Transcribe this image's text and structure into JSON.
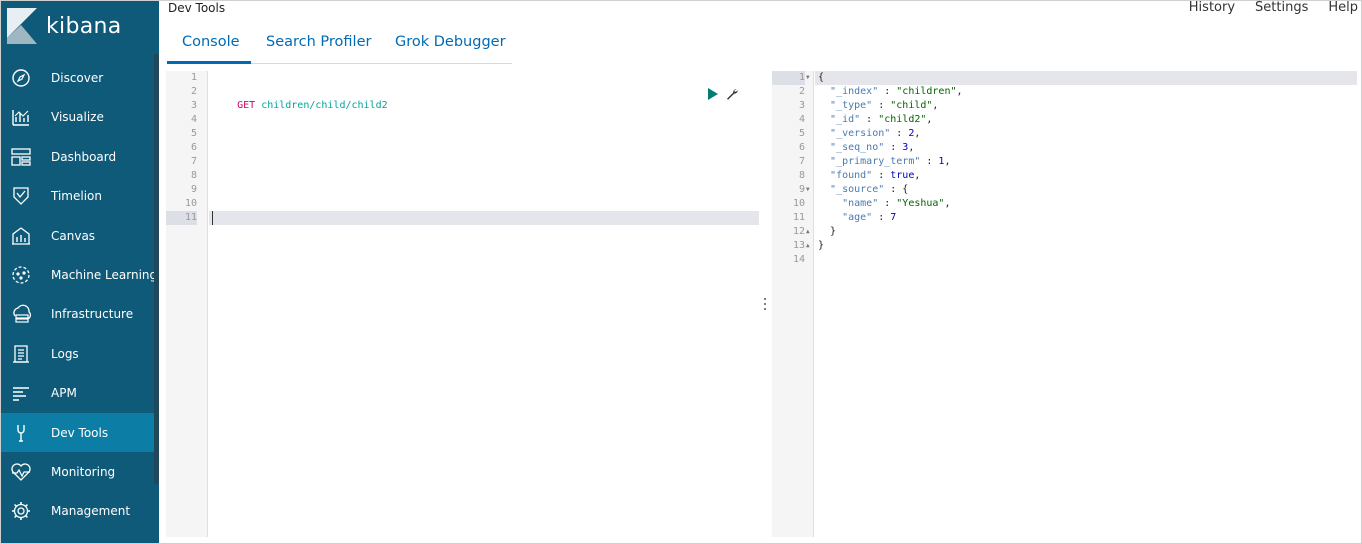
{
  "brand": {
    "name": "kibana"
  },
  "sidebar": {
    "items": [
      {
        "label": "Discover",
        "icon": "compass-icon",
        "active": false
      },
      {
        "label": "Visualize",
        "icon": "visualize-icon",
        "active": false
      },
      {
        "label": "Dashboard",
        "icon": "dashboard-icon",
        "active": false
      },
      {
        "label": "Timelion",
        "icon": "timelion-icon",
        "active": false
      },
      {
        "label": "Canvas",
        "icon": "canvas-icon",
        "active": false
      },
      {
        "label": "Machine Learning",
        "icon": "machine-learning-icon",
        "active": false
      },
      {
        "label": "Infrastructure",
        "icon": "infrastructure-icon",
        "active": false
      },
      {
        "label": "Logs",
        "icon": "logs-icon",
        "active": false
      },
      {
        "label": "APM",
        "icon": "apm-icon",
        "active": false
      },
      {
        "label": "Dev Tools",
        "icon": "wrench-icon",
        "active": true
      },
      {
        "label": "Monitoring",
        "icon": "heartbeat-icon",
        "active": false
      },
      {
        "label": "Management",
        "icon": "gear-icon",
        "active": false
      }
    ]
  },
  "header": {
    "title": "Dev Tools",
    "links": [
      "History",
      "Settings",
      "Help"
    ]
  },
  "tabs": [
    {
      "label": "Console",
      "active": true
    },
    {
      "label": "Search Profiler",
      "active": false
    },
    {
      "label": "Grok Debugger",
      "active": false
    }
  ],
  "request_editor": {
    "line_numbers": [
      "1",
      "2",
      "3",
      "4",
      "5",
      "6",
      "7",
      "8",
      "9",
      "10",
      "11"
    ],
    "method": "GET",
    "path": "children/child/child2",
    "active_line": "11"
  },
  "response_editor": {
    "line_numbers": [
      "1",
      "2",
      "3",
      "4",
      "5",
      "6",
      "7",
      "8",
      "9",
      "10",
      "11",
      "12",
      "13",
      "14"
    ],
    "lines": [
      {
        "indent": "",
        "tokens": [
          {
            "t": "{",
            "c": "punc"
          }
        ]
      },
      {
        "indent": "  ",
        "tokens": [
          {
            "t": "\"_index\"",
            "c": "key"
          },
          {
            "t": " : ",
            "c": "punc"
          },
          {
            "t": "\"children\"",
            "c": "str"
          },
          {
            "t": ",",
            "c": "punc"
          }
        ]
      },
      {
        "indent": "  ",
        "tokens": [
          {
            "t": "\"_type\"",
            "c": "key"
          },
          {
            "t": " : ",
            "c": "punc"
          },
          {
            "t": "\"child\"",
            "c": "str"
          },
          {
            "t": ",",
            "c": "punc"
          }
        ]
      },
      {
        "indent": "  ",
        "tokens": [
          {
            "t": "\"_id\"",
            "c": "key"
          },
          {
            "t": " : ",
            "c": "punc"
          },
          {
            "t": "\"child2\"",
            "c": "str"
          },
          {
            "t": ",",
            "c": "punc"
          }
        ]
      },
      {
        "indent": "  ",
        "tokens": [
          {
            "t": "\"_version\"",
            "c": "key"
          },
          {
            "t": " : ",
            "c": "punc"
          },
          {
            "t": "2",
            "c": "num"
          },
          {
            "t": ",",
            "c": "punc"
          }
        ]
      },
      {
        "indent": "  ",
        "tokens": [
          {
            "t": "\"_seq_no\"",
            "c": "key"
          },
          {
            "t": " : ",
            "c": "punc"
          },
          {
            "t": "3",
            "c": "num"
          },
          {
            "t": ",",
            "c": "punc"
          }
        ]
      },
      {
        "indent": "  ",
        "tokens": [
          {
            "t": "\"_primary_term\"",
            "c": "key"
          },
          {
            "t": " : ",
            "c": "punc"
          },
          {
            "t": "1",
            "c": "num"
          },
          {
            "t": ",",
            "c": "punc"
          }
        ]
      },
      {
        "indent": "  ",
        "tokens": [
          {
            "t": "\"found\"",
            "c": "key"
          },
          {
            "t": " : ",
            "c": "punc"
          },
          {
            "t": "true",
            "c": "bool"
          },
          {
            "t": ",",
            "c": "punc"
          }
        ]
      },
      {
        "indent": "  ",
        "tokens": [
          {
            "t": "\"_source\"",
            "c": "key"
          },
          {
            "t": " : ",
            "c": "punc"
          },
          {
            "t": "{",
            "c": "punc"
          }
        ]
      },
      {
        "indent": "    ",
        "tokens": [
          {
            "t": "\"name\"",
            "c": "key"
          },
          {
            "t": " : ",
            "c": "punc"
          },
          {
            "t": "\"Yeshua\"",
            "c": "str"
          },
          {
            "t": ",",
            "c": "punc"
          }
        ]
      },
      {
        "indent": "    ",
        "tokens": [
          {
            "t": "\"age\"",
            "c": "key"
          },
          {
            "t": " : ",
            "c": "punc"
          },
          {
            "t": "7",
            "c": "num"
          }
        ]
      },
      {
        "indent": "  ",
        "tokens": [
          {
            "t": "}",
            "c": "punc"
          }
        ]
      },
      {
        "indent": "",
        "tokens": [
          {
            "t": "}",
            "c": "punc"
          }
        ]
      },
      {
        "indent": "",
        "tokens": []
      }
    ],
    "fold_down_lines": [
      "1",
      "9"
    ],
    "fold_up_lines": [
      "12",
      "13"
    ]
  },
  "colors": {
    "sidebar_bg": "#0f5a78",
    "sidebar_active": "#0c7ea6",
    "accent": "#006bb4",
    "method": "#c80a68",
    "path": "#00a69b",
    "play_button": "#017d73"
  }
}
